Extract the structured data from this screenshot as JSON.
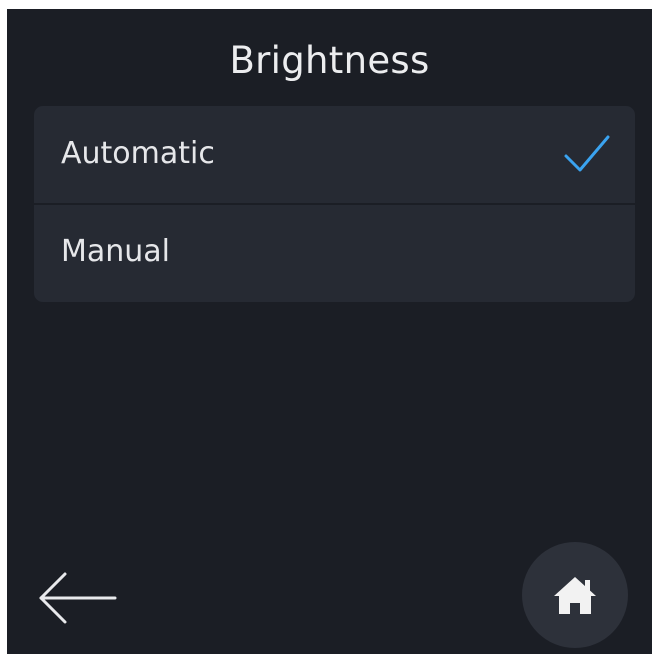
{
  "header": {
    "title": "Brightness"
  },
  "options": [
    {
      "label": "Automatic",
      "selected": true
    },
    {
      "label": "Manual",
      "selected": false
    }
  ],
  "footer": {
    "back_icon": "arrow-left-icon",
    "home_icon": "home-icon"
  },
  "colors": {
    "background": "#1b1e25",
    "list_background": "#262a33",
    "text": "#e6e7ea",
    "accent": "#3aa3f0",
    "home_button_background": "#2d313a",
    "home_icon": "#f2f2f2"
  }
}
